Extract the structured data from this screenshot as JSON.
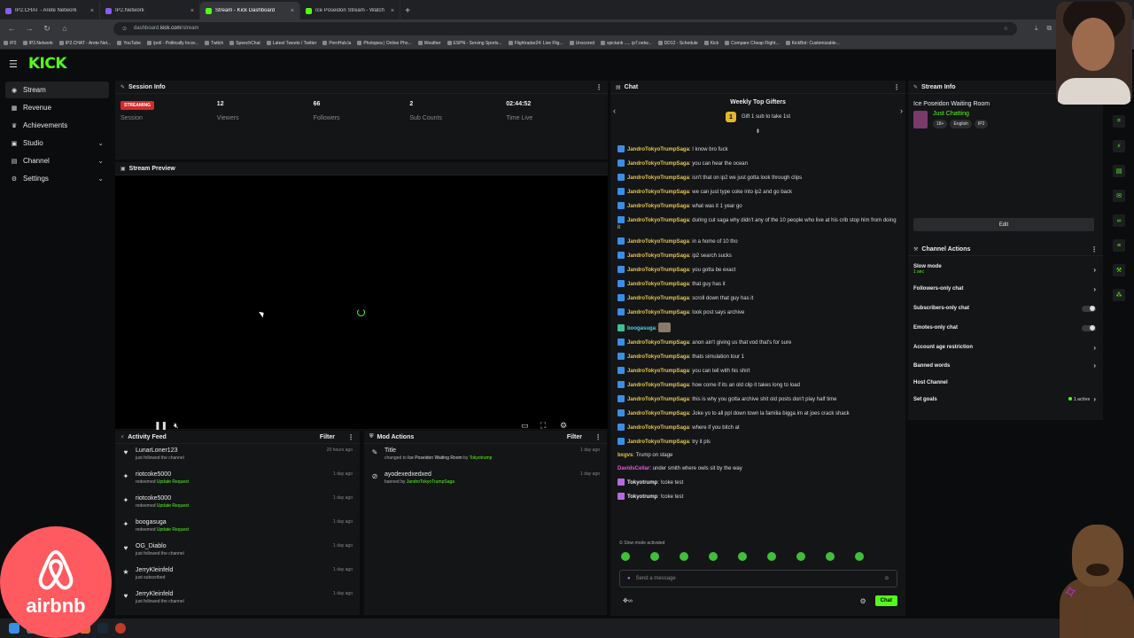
{
  "browser": {
    "tabs": [
      {
        "label": "IP2.CHAT - Arete Network",
        "active": false
      },
      {
        "label": "IP2.Network",
        "active": false
      },
      {
        "label": "Stream - Kick Dashboard",
        "active": true
      },
      {
        "label": "Ice Poseidon Stream - Watch",
        "active": false
      }
    ],
    "url_prefix": "dashboard.",
    "url_host": "kick.com",
    "url_path": "/stream",
    "bookmarks": [
      "IP2",
      "IP2.Network",
      "IP2.CHAT - Arete Net...",
      "YouTube",
      "/pol/ - Politically Incor...",
      "Twitch",
      "SpeechChat",
      "Latest Tweets / Twitter",
      "PornHub.la",
      "Photopea | Online Pho...",
      "Weather",
      "ESPN - Serving Sports...",
      "Flightradar24: Live Flig...",
      "Unscored",
      "spictank ..... ip7.netw...",
      "DD12 - Schedule",
      "Kick",
      "Compare Cheap Flight...",
      "KickBot: Customizable..."
    ]
  },
  "app": {
    "logo": "KICK"
  },
  "sidebar": {
    "items": [
      {
        "label": "Stream",
        "icon": "broadcast-icon",
        "active": true,
        "chevron": false
      },
      {
        "label": "Revenue",
        "icon": "revenue-icon",
        "active": false,
        "chevron": false
      },
      {
        "label": "Achievements",
        "icon": "trophy-icon",
        "active": false,
        "chevron": false
      },
      {
        "label": "Studio",
        "icon": "studio-icon",
        "active": false,
        "chevron": true
      },
      {
        "label": "Channel",
        "icon": "channel-icon",
        "active": false,
        "chevron": true
      },
      {
        "label": "Settings",
        "icon": "gear-icon",
        "active": false,
        "chevron": true
      }
    ]
  },
  "session": {
    "title": "Session Info",
    "status_badge": "STREAMING",
    "session_label": "Session",
    "stats": [
      {
        "value": "12",
        "label": "Viewers"
      },
      {
        "value": "66",
        "label": "Followers"
      },
      {
        "value": "2",
        "label": "Sub Counts"
      },
      {
        "value": "02:44:52",
        "label": "Time Live"
      }
    ]
  },
  "preview": {
    "title": "Stream Preview"
  },
  "activity": {
    "title": "Activity Feed",
    "filter_label": "Filter",
    "items": [
      {
        "name": "LunarLoner123",
        "pre": "just followed the channel",
        "highlight": "",
        "time": "20 hours ago",
        "icon": "heart-icon"
      },
      {
        "name": "riotcoke5000",
        "pre": "redeemed ",
        "highlight": "Update Request",
        "time": "1 day ago",
        "icon": "points-icon"
      },
      {
        "name": "riotcoke5000",
        "pre": "redeemed ",
        "highlight": "Update Request",
        "time": "1 day ago",
        "icon": "points-icon"
      },
      {
        "name": "boogasuga",
        "pre": "redeemed ",
        "highlight": "Update Request",
        "time": "1 day ago",
        "icon": "points-icon"
      },
      {
        "name": "OG_Diablo",
        "pre": "just followed the channel",
        "highlight": "",
        "time": "1 day ago",
        "icon": "heart-icon"
      },
      {
        "name": "JerryKleinfeld",
        "pre": "just subscribed",
        "highlight": "",
        "time": "1 day ago",
        "icon": "star-icon"
      },
      {
        "name": "JerryKleinfeld",
        "pre": "just followed the channel",
        "highlight": "",
        "time": "1 day ago",
        "icon": "heart-icon"
      }
    ]
  },
  "mod": {
    "title": "Mod Actions",
    "filter_label": "Filter",
    "items": [
      {
        "name": "Title",
        "pre": "changed to ",
        "target": "Ice Poseidon Waiting Room",
        "mid": " by ",
        "by": "Tokyotrump",
        "time": "1 day ago",
        "icon": "edit-icon"
      },
      {
        "name": "ayodexedxedxed",
        "pre": "banned by ",
        "target": "",
        "mid": "",
        "by": "JandroTokyoTrumpSaga",
        "time": "1 day ago",
        "icon": "ban-icon"
      }
    ]
  },
  "chat": {
    "title": "Chat",
    "gifters_title": "Weekly Top Gifters",
    "gift_rank": "1",
    "gift_text": "Gift 1 sub to take 1st",
    "messages": [
      {
        "user": "JandroTokyoTrumpSaga",
        "color": "#e8c74a",
        "text": "I know bro fuck",
        "badge": true
      },
      {
        "user": "JandroTokyoTrumpSaga",
        "color": "#e8c74a",
        "text": "you can hear the ocean",
        "badge": true
      },
      {
        "user": "JandroTokyoTrumpSaga",
        "color": "#e8c74a",
        "text": "isn't that on ip2 we just gotta look through clips",
        "badge": true
      },
      {
        "user": "JandroTokyoTrumpSaga",
        "color": "#e8c74a",
        "text": "we can just type coke into ip2 and go back",
        "badge": true
      },
      {
        "user": "JandroTokyoTrumpSaga",
        "color": "#e8c74a",
        "text": "what was it 1 year go",
        "badge": true
      },
      {
        "user": "JandroTokyoTrumpSaga",
        "color": "#e8c74a",
        "text": "during cut saga why didn't any of the 10 people who live at his crib stop him from doing it",
        "badge": true
      },
      {
        "user": "JandroTokyoTrumpSaga",
        "color": "#e8c74a",
        "text": "in a home of 10 tho",
        "badge": true
      },
      {
        "user": "JandroTokyoTrumpSaga",
        "color": "#e8c74a",
        "text": "ip2 search sucks",
        "badge": true
      },
      {
        "user": "JandroTokyoTrumpSaga",
        "color": "#e8c74a",
        "text": "you gotta be exact",
        "badge": true
      },
      {
        "user": "JandroTokyoTrumpSaga",
        "color": "#e8c74a",
        "text": "that guy has it",
        "badge": true
      },
      {
        "user": "JandroTokyoTrumpSaga",
        "color": "#e8c74a",
        "text": "scroll down that guy has it",
        "badge": true
      },
      {
        "user": "JandroTokyoTrumpSaga",
        "color": "#e8c74a",
        "text": "look post says archive",
        "badge": true
      },
      {
        "user": "boogasuga",
        "color": "#53d1e8",
        "text": "",
        "badge": true
      },
      {
        "user": "JandroTokyoTrumpSaga",
        "color": "#e8c74a",
        "text": "anon ain't giving us that vod that's for sure",
        "badge": true
      },
      {
        "user": "JandroTokyoTrumpSaga",
        "color": "#e8c74a",
        "text": "thats simulation tour 1",
        "badge": true
      },
      {
        "user": "JandroTokyoTrumpSaga",
        "color": "#e8c74a",
        "text": "you can tell with his shirt",
        "badge": true
      },
      {
        "user": "JandroTokyoTrumpSaga",
        "color": "#e8c74a",
        "text": "how come if its an old clip it takes long to load",
        "badge": true
      },
      {
        "user": "JandroTokyoTrumpSaga",
        "color": "#e8c74a",
        "text": "this is why you gotta archive shit old posts don't play half time",
        "badge": true
      },
      {
        "user": "JandroTokyoTrumpSaga",
        "color": "#e8c74a",
        "text": "Joke yo to all ppl down town la familia bigga im at joes crack shack",
        "badge": true
      },
      {
        "user": "JandroTokyoTrumpSaga",
        "color": "#e8c74a",
        "text": "where if you bitch at",
        "badge": true
      },
      {
        "user": "JandroTokyoTrumpSaga",
        "color": "#e8c74a",
        "text": "try it pls",
        "badge": true
      },
      {
        "user": "bxgvs",
        "color": "#e8c74a",
        "text": "Trump on stage",
        "badge": false
      },
      {
        "user": "DavidsCellar",
        "color": "#e85ad8",
        "text": "under smith where owls sit by the way",
        "badge": false
      },
      {
        "user": "Tokyotrump",
        "color": "#e6e6e6",
        "text": "!coke test",
        "badge": true
      },
      {
        "user": "Tokyotrump",
        "color": "#e6e6e6",
        "text": "!coke test",
        "badge": true
      }
    ],
    "slow_mode_note": "Slow mode activated",
    "input_placeholder": "Send a message",
    "send_label": "Chat"
  },
  "stream_info": {
    "title": "Stream Info",
    "stream_title": "Ice Poseidon Waiting Room",
    "category": "Just Chatting",
    "tags": [
      "18+",
      "English",
      "IP2"
    ],
    "edit_label": "Edit"
  },
  "channel_actions": {
    "title": "Channel Actions",
    "items": [
      {
        "label": "Slow mode",
        "sub": "1 sec",
        "control": "chevron"
      },
      {
        "label": "Followers-only chat",
        "sub": "",
        "control": "chevron"
      },
      {
        "label": "Subscribers-only chat",
        "sub": "",
        "control": "toggle"
      },
      {
        "label": "Emotes-only chat",
        "sub": "",
        "control": "toggle"
      },
      {
        "label": "Account age restriction",
        "sub": "",
        "control": "chevron"
      },
      {
        "label": "Banned words",
        "sub": "",
        "control": "chevron"
      },
      {
        "label": "Host Channel",
        "sub": "",
        "control": "none"
      },
      {
        "label": "Set goals",
        "sub": "",
        "control": "chevron",
        "status": "1 active"
      }
    ]
  },
  "overlays": {
    "sponsor": "airbnb",
    "webcam_icon": "webcam-person-icon",
    "corner_icon": "wookiee-icon"
  },
  "colors": {
    "accent": "#53fc18",
    "streaming_badge": "#d62a2a",
    "background": "#0b0c0d",
    "panel": "#141517"
  }
}
